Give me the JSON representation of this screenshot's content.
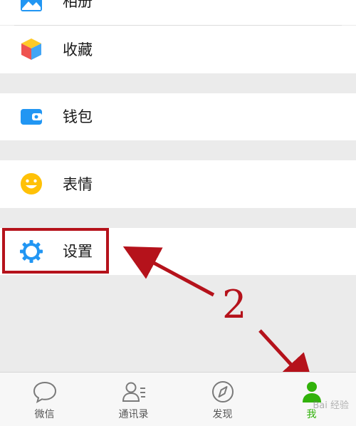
{
  "rows": {
    "album": {
      "label": "相册"
    },
    "favorites": {
      "label": "收藏"
    },
    "wallet": {
      "label": "钱包"
    },
    "stickers": {
      "label": "表情"
    },
    "settings": {
      "label": "设置"
    }
  },
  "tabbar": {
    "chats": {
      "label": "微信",
      "icon": "chat-bubble-icon"
    },
    "contacts": {
      "label": "通讯录",
      "icon": "contacts-icon"
    },
    "discover": {
      "label": "发现",
      "icon": "compass-icon"
    },
    "me": {
      "label": "我",
      "icon": "person-icon",
      "active": true
    }
  },
  "annotation": {
    "step": "2"
  },
  "watermark": {
    "text": "Bai 经验"
  },
  "colors": {
    "background": "#ebebeb",
    "row": "#ffffff",
    "accent_green": "#31b20a",
    "annotation_red": "#b5121b",
    "icon_blue": "#2196f3",
    "icon_yellow": "#ffc107"
  }
}
